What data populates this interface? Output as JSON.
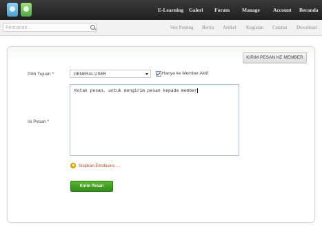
{
  "topnav": {
    "items": [
      "E-Learning",
      "Galeri",
      "Forum",
      "Manage",
      "Account",
      "Beranda"
    ]
  },
  "search": {
    "placeholder": "Pencarian ..."
  },
  "subnav": {
    "items": [
      "Site Posting",
      "Berita",
      "Artikel",
      "Kegiatan",
      "Catatan",
      "Download"
    ]
  },
  "colors": {
    "topbar": "#2a2a2a",
    "accent_green": "#3f9c22",
    "link": "#b04010"
  },
  "form": {
    "header_button": "KIRIM PESAN KE MEMBER",
    "pilih_tujuan_label": "Pilih Tujuan *",
    "tujuan_selected": "GENERAL USER",
    "checkbox_label": "Hanya ke Member Aktif",
    "checkbox_checked": true,
    "isi_pesan_label": "Isi Pesan *",
    "message_text": "Kotak pesan, untuk mengirim pesan kepada member",
    "emoticon_link": "Sisipkan Emoticons ....",
    "submit_label": "Kirim Pesan"
  }
}
